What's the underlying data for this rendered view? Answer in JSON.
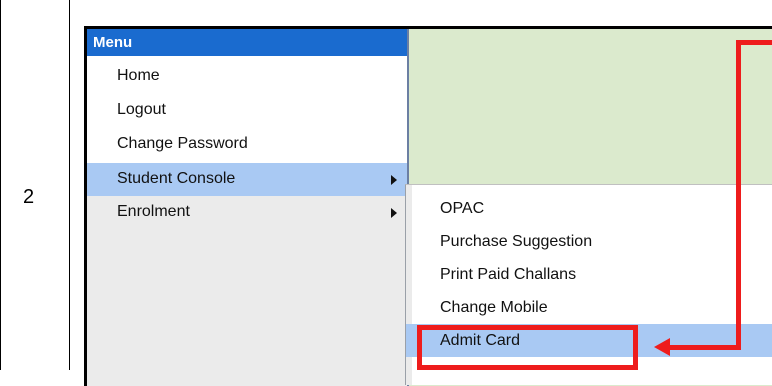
{
  "step": {
    "number": "2"
  },
  "menu": {
    "title": "Menu",
    "items": [
      {
        "label": "Home"
      },
      {
        "label": "Logout"
      },
      {
        "label": "Change Password"
      },
      {
        "label": "Student Console"
      },
      {
        "label": "Enrolment"
      }
    ]
  },
  "submenu": {
    "items": [
      {
        "label": "OPAC"
      },
      {
        "label": "Purchase Suggestion"
      },
      {
        "label": "Print Paid Challans"
      },
      {
        "label": "Change Mobile"
      },
      {
        "label": "Admit Card"
      }
    ]
  },
  "colors": {
    "menu_header": "#1a6bcf",
    "highlight": "#a9c9f3",
    "annotation": "#ee1c1c",
    "content_bg": "#dbeacd"
  },
  "icons": [
    "chevron-right-icon",
    "arrow-left-icon"
  ]
}
